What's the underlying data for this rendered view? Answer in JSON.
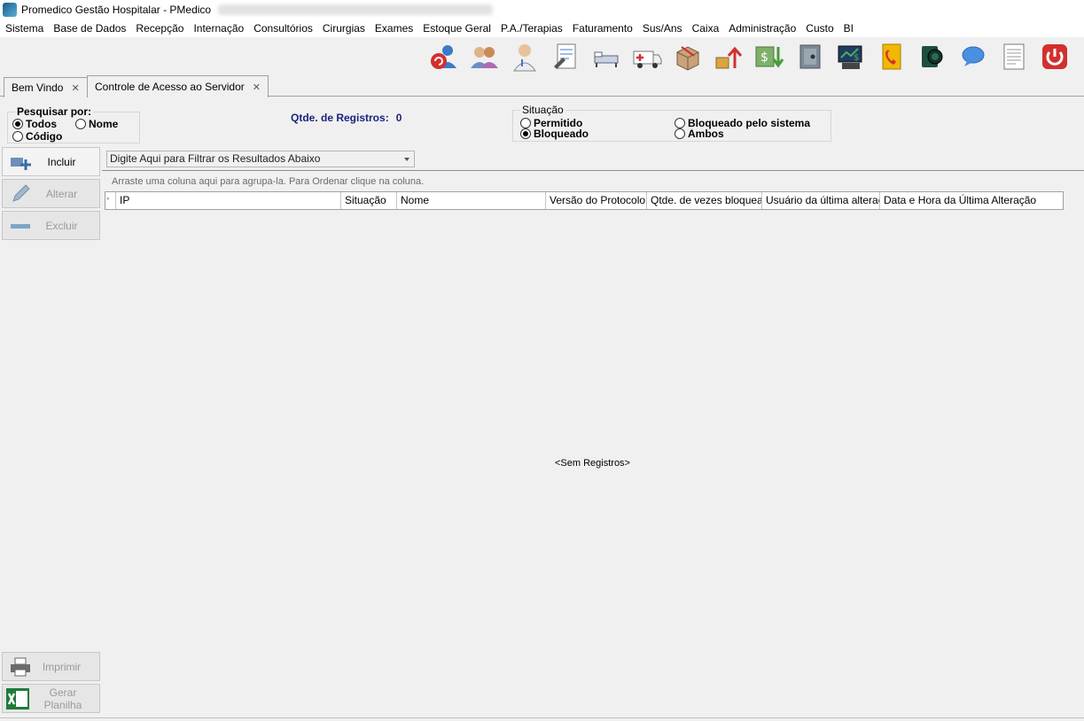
{
  "window": {
    "title": "Promedico Gestão Hospitalar - PMedico"
  },
  "menu": [
    "Sistema",
    "Base de Dados",
    "Recepção",
    "Internação",
    "Consultórios",
    "Cirurgias",
    "Exames",
    "Estoque Geral",
    "P.A./Terapias",
    "Faturamento",
    "Sus/Ans",
    "Caixa",
    "Administração",
    "Custo",
    "BI"
  ],
  "toolbar_icons": [
    "refresh-users-icon",
    "reception-icon",
    "doctor-icon",
    "prescription-icon",
    "hospital-bed-icon",
    "ambulance-icon",
    "surgery-box-icon",
    "stock-up-icon",
    "money-out-icon",
    "safe-icon",
    "cash-register-icon",
    "phonebook-icon",
    "camera-icon",
    "chat-icon",
    "document-list-icon",
    "power-icon"
  ],
  "tabs": [
    {
      "label": "Bem Vindo",
      "close": "✕"
    },
    {
      "label": "Controle de Acesso ao Servidor",
      "close": "✕"
    }
  ],
  "search": {
    "title": "Pesquisar por:",
    "options": [
      "Todos",
      "Nome",
      "Código"
    ],
    "selected": "Todos"
  },
  "count": {
    "label": "Qtde. de Registros:",
    "value": "0"
  },
  "situacao": {
    "title": "Situação",
    "options": [
      "Permitido",
      "Bloqueado pelo sistema",
      "Bloqueado",
      "Ambos"
    ],
    "selected": "Bloqueado"
  },
  "actions": {
    "incluir": "Incluir",
    "alterar": "Alterar",
    "excluir": "Excluir",
    "imprimir": "Imprimir",
    "gerar_planilha": "Gerar Planilha"
  },
  "filter": {
    "placeholder": "Digite Aqui para Filtrar os Resultados Abaixo"
  },
  "grid": {
    "group_hint": "Arraste uma coluna aqui para agrupa-la. Para Ordenar clique na coluna.",
    "selector": "*",
    "columns": [
      "IP",
      "Situação",
      "Nome",
      "Versão do Protocolo IP",
      "Qtde. de vezes bloqueado",
      "Usuário da última alteração",
      "Data e Hora da Última Alteração"
    ],
    "empty": "<Sem Registros>"
  },
  "colors": {
    "count_text": "#1a237e",
    "power": "#d32f2f"
  }
}
